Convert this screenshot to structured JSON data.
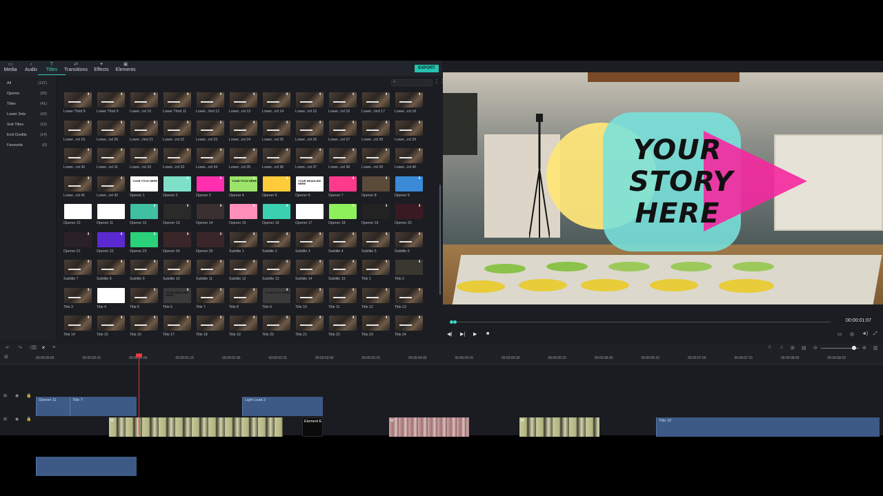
{
  "tabs": [
    {
      "label": "Media",
      "icon": "folder-icon"
    },
    {
      "label": "Audio",
      "icon": "music-icon"
    },
    {
      "label": "Titles",
      "icon": "text-icon"
    },
    {
      "label": "Transitions",
      "icon": "transition-icon"
    },
    {
      "label": "Effects",
      "icon": "effects-icon"
    },
    {
      "label": "Elements",
      "icon": "elements-icon"
    }
  ],
  "active_tab": "Titles",
  "export_label": "EXPORT",
  "categories": [
    {
      "label": "All",
      "count": "(137)"
    },
    {
      "label": "Opener",
      "count": "(25)"
    },
    {
      "label": "Titles",
      "count": "(41)"
    },
    {
      "label": "Lower 3rds",
      "count": "(42)"
    },
    {
      "label": "Sub Titles",
      "count": "(15)"
    },
    {
      "label": "End Credits",
      "count": "(14)"
    },
    {
      "label": "Favourite",
      "count": "(0)"
    }
  ],
  "library_items": [
    "Lower Third 8",
    "Lower Third 9",
    "Lower...ird 10",
    "Lower Third 11",
    "Lower...hird 12",
    "Lower...ird 13",
    "Lower...ird 14",
    "Lower...ird 15",
    "Lower...ird 16",
    "Lower...hird 17",
    "Lower...ird 18",
    "Lower...ird 19",
    "Lower...ird 20",
    "Lower...hird 21",
    "Lower...ird 22",
    "Lower...ird 23",
    "Lower...ird 24",
    "Lower...ird 25",
    "Lower...ird 26",
    "Lower...ird 27",
    "Lower...ird 28",
    "Lower...ird 29",
    "Lower...ird 30",
    "Lower...ird 31",
    "Lower...ird 32",
    "Lower...ird 33",
    "Lower...ird 34",
    "Lower...ird 35",
    "Lower...ird 36",
    "Lower...ird 37",
    "Lower...ird 38",
    "Lower...ird 39",
    "Lower...ird 40",
    "Lower...ird 41",
    "Lower...ird 42",
    "Opener 1",
    "Opener 2",
    "Opener 3",
    "Opener 4",
    "Opener 5",
    "Opener 6",
    "Opener 7",
    "Opener 8",
    "Opener 9",
    "Opener 10",
    "Opener 11",
    "Opener 12",
    "Opener 13",
    "Opener 14",
    "Opener 15",
    "Opener 16",
    "Opener 17",
    "Opener 18",
    "Opener 19",
    "Opener 20",
    "Opener 21",
    "Opener 22",
    "Opener 23",
    "Opener 24",
    "Opener 25",
    "Subtitle 1",
    "Subtitle 2",
    "Subtitle 3",
    "Subtitle 4",
    "Subtitle 5",
    "Subtitle 6",
    "Subtitle 7",
    "Subtitle 8",
    "Subtitle 9",
    "Subtitle 10",
    "Subtitle 11",
    "Subtitle 12",
    "Subtitle 13",
    "Subtitle 14",
    "Subtitle 15",
    "Title 1",
    "Title 2",
    "Title 3",
    "Title 4",
    "Title 5",
    "Title 6",
    "Title 7",
    "Title 8",
    "Title 9",
    "Title 10",
    "Title 11",
    "Title 12",
    "Title 13",
    "Title 14",
    "Title 15",
    "Title 16",
    "Title 17",
    "Title 18",
    "Title 19",
    "Title 20",
    "Title 21",
    "Title 22",
    "Title 23",
    "Title 24"
  ],
  "thumb_text": {
    "your_title_here": "YOUR TITLE HERE",
    "your_headline_here": "YOUR HEADLINE HERE",
    "title_here": "TITLE HERE"
  },
  "preview": {
    "overlay_text": "YOUR STORY HERE",
    "timecode": "00:00:01:07"
  },
  "ruler_ticks": [
    "00:00:00:00",
    "00:00:00:15",
    "00:00:01:00",
    "00:00:01:15",
    "00:00:02:00",
    "00:00:02:15",
    "00:00:03:00",
    "00:00:03:15",
    "00:00:04:00",
    "00:00:04:15",
    "00:00:05:00",
    "00:00:05:15",
    "00:00:06:00",
    "00:00:06:15",
    "00:00:07:00",
    "00:00:07:15",
    "00:00:08:00",
    "00:00:08:15"
  ],
  "clips": {
    "opener11": "Opener 11",
    "title7": "Title 7",
    "light_leak": "Light Leak 2",
    "title10": "Title 10",
    "element": "Element E",
    "media1": "M",
    "media2": "M",
    "media3": "M"
  },
  "colors": {
    "accent": "#26c3b0",
    "playhead": "#e53b3b",
    "clip_blue": "#3d5a87"
  }
}
